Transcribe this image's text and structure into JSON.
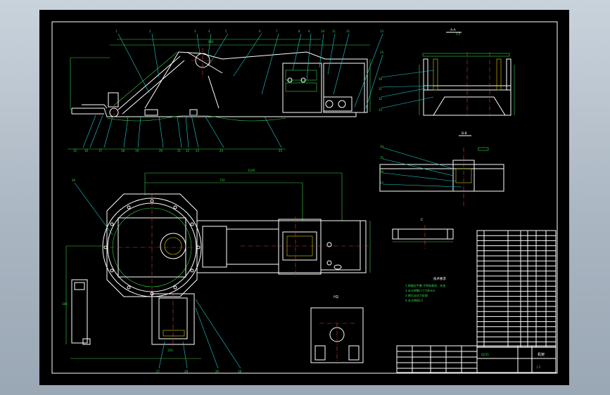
{
  "colors": {
    "background_top": "#c9d3dc",
    "sheet": "#000000",
    "outline": "#ffffff",
    "dimension": "#37d44a",
    "centerline": "#e04040",
    "hatch": "#e0d000",
    "leader": "#22d0d0"
  },
  "section_labels": {
    "section_a": "A-A",
    "section_b": "B-B",
    "view_c": "C",
    "view_p": "P向"
  },
  "scale_label": "1:5",
  "dimensions": {
    "top_view_length": "660",
    "plan_length": "1100",
    "plan_width": "720",
    "side_height": "180",
    "bottom_width": "150"
  },
  "tech_requirements": {
    "title": "技术要求",
    "items": [
      "1.焊缝应平整,不得有裂纹、夹渣",
      "2.未注焊脚尺寸为6mm",
      "3.焊后去应力处理",
      "4.未注倒角C2"
    ]
  },
  "title_block": {
    "drawing_name": "机架",
    "material": "Q235",
    "scale": "1:5"
  },
  "icons": [
    "balloon-callout-icon",
    "section-arrow-icon",
    "centerline-mark-icon"
  ]
}
